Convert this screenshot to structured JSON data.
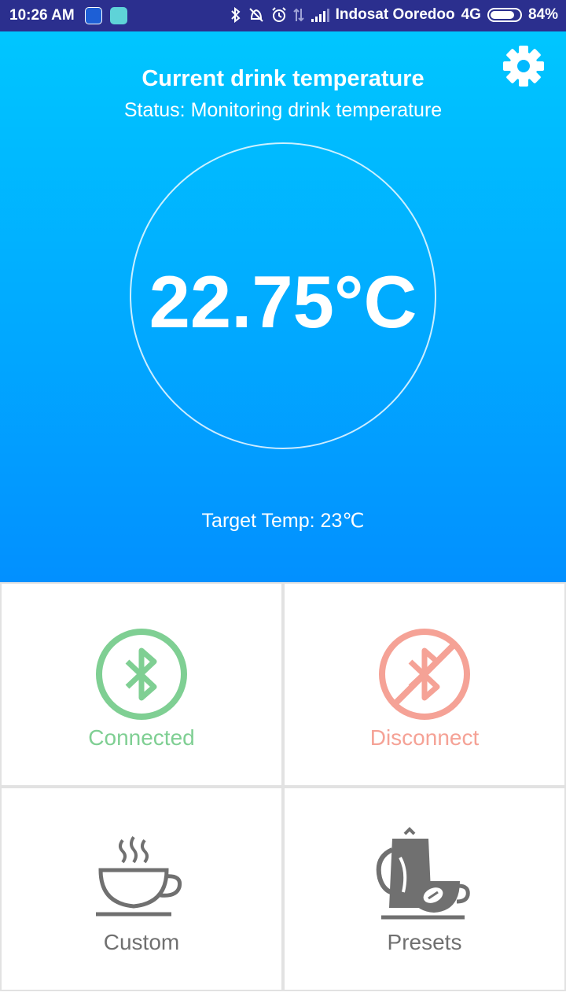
{
  "status_bar": {
    "time": "10:26 AM",
    "carrier": "Indosat Ooredoo",
    "network": "4G",
    "battery": "84%",
    "battery_level": 0.84,
    "background_color": "#2b2f8e"
  },
  "header": {
    "title": "Current drink temperature",
    "status": "Status: Monitoring drink temperature",
    "gradient_top": "#00c6ff",
    "gradient_bottom": "#0290ff",
    "settings_icon": "gear-icon"
  },
  "temperature": {
    "current": "22.75°C",
    "target": "Target Temp: 23℃"
  },
  "tiles": {
    "connected": {
      "label": "Connected",
      "icon": "bluetooth-icon",
      "color": "#7fcf93"
    },
    "disconnect": {
      "label": "Disconnect",
      "icon": "bluetooth-disabled-icon",
      "color": "#f5a296"
    },
    "custom": {
      "label": "Custom",
      "icon": "steaming-cup-icon",
      "color": "#707070"
    },
    "presets": {
      "label": "Presets",
      "icon": "kettle-cup-icon",
      "color": "#707070"
    }
  }
}
